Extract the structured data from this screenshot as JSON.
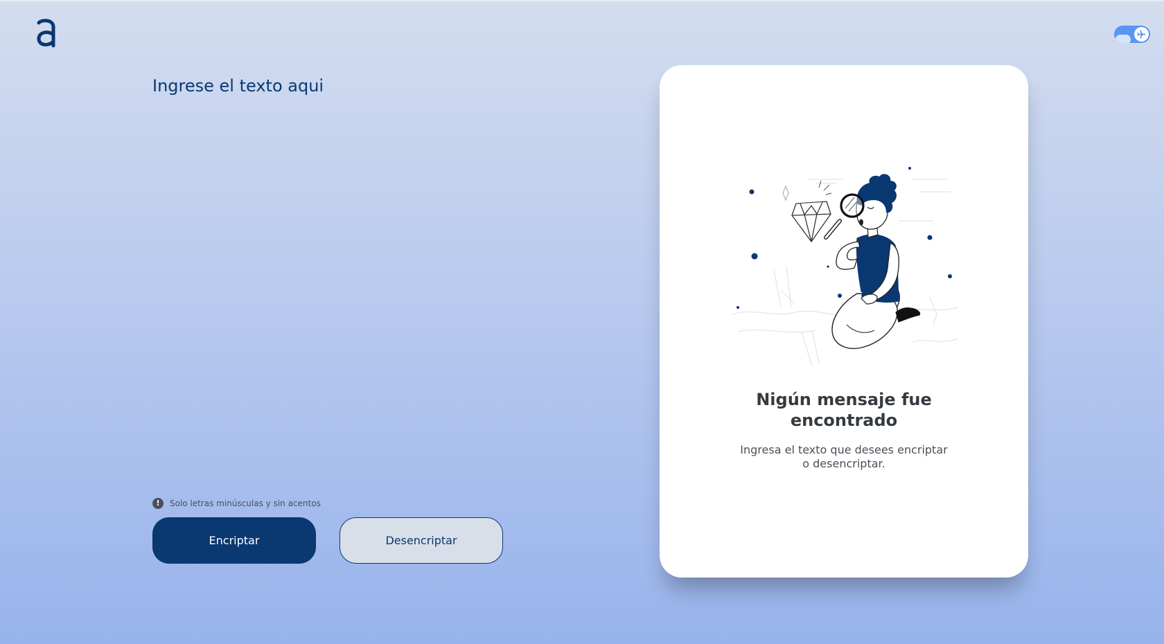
{
  "brand": {
    "logo_icon": "alura-logo-icon"
  },
  "theme_toggle": {
    "icon": "airplane-icon"
  },
  "input": {
    "placeholder": "Ingrese el texto aqui",
    "value": ""
  },
  "hint": {
    "icon": "exclamation-circle-icon",
    "text": "Solo letras minúsculas y sin acentos"
  },
  "buttons": {
    "encrypt_label": "Encriptar",
    "decrypt_label": "Desencriptar"
  },
  "output": {
    "illustration": "person-inspecting-diamond-illustration",
    "title": "Nigún mensaje fue encontrado",
    "description": "Ingresa el texto que desees encriptar o desencriptar."
  },
  "colors": {
    "primary": "#0a3871",
    "secondary_bg": "#d8dfe8",
    "card_bg": "#ffffff",
    "toggle": "#5b95ef",
    "text_muted": "#495057",
    "title": "#343a40"
  }
}
